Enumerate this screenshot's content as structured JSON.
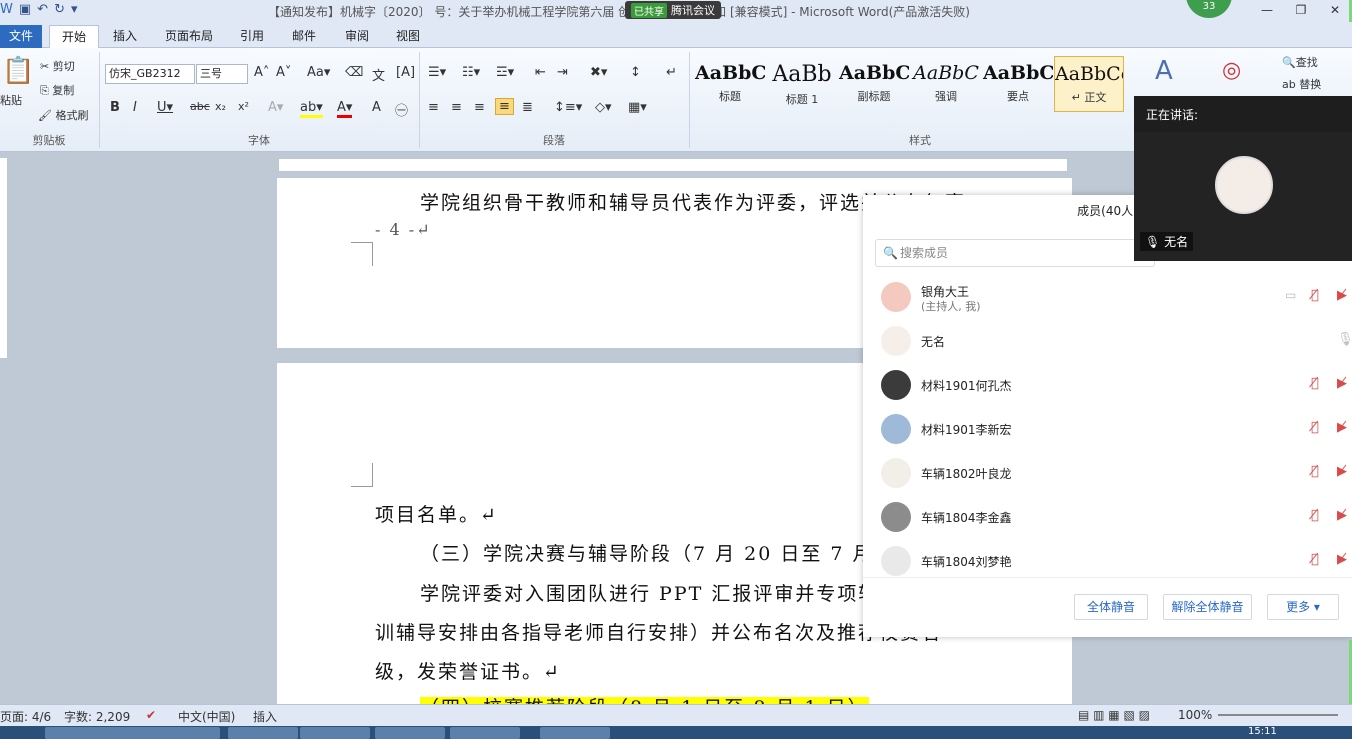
{
  "titlebar": {
    "title": "【通知发布】机械字〔2020〕  号：关于举办机械工程学院第六届    创新创业比赛的通知 [兼容模式] - Microsoft Word(产品激活失败)",
    "meeting_badge_tag": "已共享",
    "meeting_badge": "腾讯会议",
    "participant_count": "33",
    "min": "—",
    "restore": "❐",
    "close": "✕"
  },
  "tabs": [
    "文件",
    "开始",
    "插入",
    "页面布局",
    "引用",
    "邮件",
    "审阅",
    "视图"
  ],
  "clipboard": {
    "paste": "粘贴",
    "cut": "剪切",
    "copy": "复制",
    "format_painter": "格式刷",
    "group": "剪贴板"
  },
  "font": {
    "name": "仿宋_GB2312",
    "size": "三号",
    "group": "字体"
  },
  "paragraph": {
    "group": "段落"
  },
  "styles": {
    "group": "样式",
    "items": [
      {
        "sample": "AaBbC(",
        "label": "标题"
      },
      {
        "sample": "AaBb",
        "label": "标题 1"
      },
      {
        "sample": "AaBbC(",
        "label": "副标题"
      },
      {
        "sample": "AaBbC",
        "label": "强调"
      },
      {
        "sample": "AaBbC(",
        "label": "要点"
      },
      {
        "sample": "AaBbCc",
        "label": "↵ 正文"
      }
    ],
    "change_styles": "更改样式"
  },
  "editing": {
    "find": "查找",
    "replace": "替换"
  },
  "document": {
    "p1_line": "学院组织骨干教师和辅导员代表作为评委，评选并公布复赛",
    "page_number": "- 4 -↵",
    "line1": "项目名单。↵",
    "line2": "（三）学院决赛与辅导阶段（7 月 20 日至 7 月 3",
    "line3": "学院评委对入围团队进行 PPT 汇报评审并专项辅",
    "line4": "训辅导安排由各指导老师自行安排）并公布名次及推荐校赛名",
    "line5": "级，发荣誉证书。↵",
    "line6": "（四）校赛推荐阶段（8 月 1 日至 8 月 1 日）"
  },
  "statusbar": {
    "page": "页面: 4/6",
    "words": "字数: 2,209",
    "lang": "中文(中国)",
    "mode": "插入",
    "zoom": "100%"
  },
  "taskbar": {
    "time": "15:11"
  },
  "members_panel": {
    "header": "成员(40人)",
    "search_placeholder": "搜索成员",
    "members": [
      {
        "name": "银角大王",
        "sub": "(主持人, 我)"
      },
      {
        "name": "无名",
        "sub": ""
      },
      {
        "name": "材料1901何孔杰",
        "sub": ""
      },
      {
        "name": "材料1901李新宏",
        "sub": ""
      },
      {
        "name": "车辆1802叶良龙",
        "sub": ""
      },
      {
        "name": "车辆1804李金鑫",
        "sub": ""
      },
      {
        "name": "车辆1804刘梦艳",
        "sub": ""
      }
    ],
    "mute_all": "全体静音",
    "unmute_all": "解除全体静音",
    "more": "更多 ▾"
  },
  "speaker": {
    "label": "正在讲话:",
    "name": "无名"
  },
  "colors": {
    "file_tab": "#2d6bc0",
    "highlight": "#ffff00",
    "accent": "#2a69c8",
    "mute_red": "#d94a4a"
  }
}
